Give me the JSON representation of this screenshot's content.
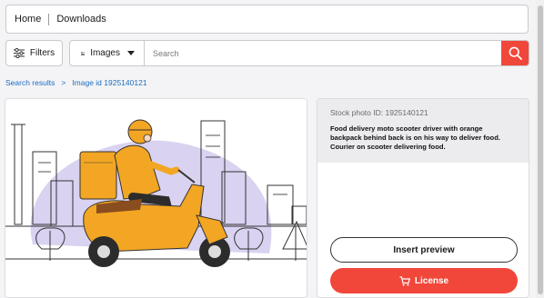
{
  "breadcrumb_top": {
    "home": "Home",
    "downloads": "Downloads"
  },
  "filters": {
    "label": "Filters"
  },
  "search": {
    "type_label": "Images",
    "placeholder": "Search"
  },
  "breadcrumb": {
    "results": "Search results",
    "separator": ">",
    "current": "Image id 1925140121"
  },
  "detail": {
    "stock_id": "Stock photo ID: 1925140121",
    "description": "Food delivery moto scooter driver with orange backpack behind back is on his way to deliver food. Courier on scooter delivering food.",
    "insert_preview": "Insert preview",
    "license": "License"
  },
  "colors": {
    "accent": "#f0473a",
    "link": "#1b6dc1",
    "illustration_orange": "#f2a623",
    "illustration_lavender": "#d9d2f1"
  }
}
